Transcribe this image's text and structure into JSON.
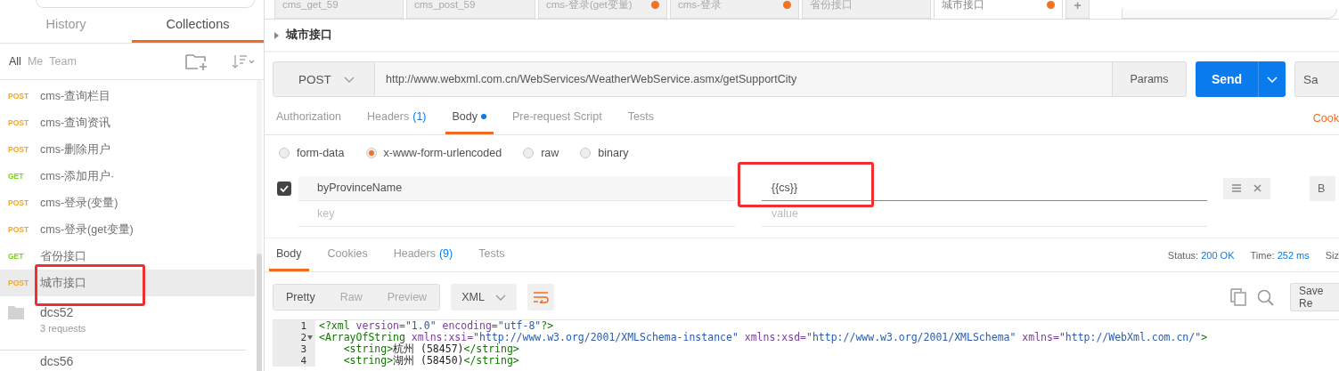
{
  "sidebar": {
    "tabs": [
      {
        "label": "History",
        "selected": false
      },
      {
        "label": "Collections",
        "selected": true
      }
    ],
    "filters": [
      {
        "label": "All",
        "selected": true
      },
      {
        "label": "Me",
        "selected": false
      },
      {
        "label": "Team",
        "selected": false
      }
    ],
    "requests": [
      {
        "method": "POST",
        "name": "cms-查询栏目",
        "selected": false,
        "highlighted": false
      },
      {
        "method": "POST",
        "name": "cms-查询资讯",
        "selected": false,
        "highlighted": false
      },
      {
        "method": "POST",
        "name": "cms-删除用户",
        "selected": false,
        "highlighted": false
      },
      {
        "method": "GET",
        "name": "cms-添加用户·",
        "selected": false,
        "highlighted": false
      },
      {
        "method": "POST",
        "name": "cms-登录(变量)",
        "selected": false,
        "highlighted": false
      },
      {
        "method": "POST",
        "name": "cms-登录(get变量)",
        "selected": false,
        "highlighted": false
      },
      {
        "method": "GET",
        "name": "省份接口",
        "selected": false,
        "highlighted": false
      },
      {
        "method": "POST",
        "name": "城市接口",
        "selected": true,
        "highlighted": true
      }
    ],
    "folders": [
      {
        "name": "dcs52",
        "count": "3 requests"
      },
      {
        "name": "dcs56"
      }
    ]
  },
  "tabs": [
    {
      "label": "cms_get_59",
      "unsaved": false,
      "selected": false
    },
    {
      "label": "cms_post_59",
      "unsaved": false,
      "selected": false
    },
    {
      "label": "cms-登录(get变量)",
      "unsaved": true,
      "selected": false
    },
    {
      "label": "cms-登录",
      "unsaved": true,
      "selected": false
    },
    {
      "label": "省份接口",
      "unsaved": false,
      "selected": false
    },
    {
      "label": "城市接口",
      "unsaved": true,
      "selected": true
    }
  ],
  "new_tab": "+",
  "request_title": "城市接口",
  "url_bar": {
    "method": "POST",
    "url": "http://www.webxml.com.cn/WebServices/WeatherWebService.asmx/getSupportCity",
    "params": "Params",
    "send": "Send",
    "save": "Sa"
  },
  "request_tabs": [
    {
      "label": "Authorization",
      "dot": false,
      "selected": false
    },
    {
      "label": "Headers",
      "count": "(1)",
      "dot": false,
      "selected": false
    },
    {
      "label": "Body",
      "dot": true,
      "selected": true
    },
    {
      "label": "Pre-request Script",
      "dot": false,
      "selected": false
    },
    {
      "label": "Tests",
      "dot": false,
      "selected": false
    }
  ],
  "cookies_link": "Cook",
  "body_types": [
    {
      "label": "form-data",
      "selected": false
    },
    {
      "label": "x-www-form-urlencoded",
      "selected": true
    },
    {
      "label": "raw",
      "selected": false
    },
    {
      "label": "binary",
      "selected": false
    }
  ],
  "params": [
    {
      "checked": true,
      "key": "byProvinceName",
      "value": "{{cs}}",
      "highlighted": true
    }
  ],
  "new_param": {
    "key_placeholder": "key",
    "value_placeholder": "value"
  },
  "bulk_edit": "B",
  "response_tabs": [
    {
      "label": "Body",
      "selected": true
    },
    {
      "label": "Cookies",
      "selected": false
    },
    {
      "label": "Headers",
      "count": "(9)",
      "selected": false
    },
    {
      "label": "Tests",
      "selected": false
    }
  ],
  "status": [
    {
      "label": "Status:",
      "value": "200 OK"
    },
    {
      "label": "Time:",
      "value": "252 ms"
    }
  ],
  "size_label": "Siz",
  "view_modes": [
    {
      "label": "Pretty",
      "selected": true
    },
    {
      "label": "Raw",
      "selected": false
    },
    {
      "label": "Preview",
      "selected": false
    }
  ],
  "format": "XML",
  "save_response": "Save Re",
  "code": [
    {
      "number": "1",
      "foldable": false,
      "tokens": [
        {
          "kind": "tag",
          "text": "<?xml "
        },
        {
          "kind": "attr",
          "text": "version="
        },
        {
          "kind": "string",
          "text": "\"1.0\""
        },
        {
          "kind": "attr",
          "text": " encoding="
        },
        {
          "kind": "string",
          "text": "\"utf-8\""
        },
        {
          "kind": "tag",
          "text": "?>"
        }
      ]
    },
    {
      "number": "2",
      "foldable": true,
      "tokens": [
        {
          "kind": "tag",
          "text": "<ArrayOfString "
        },
        {
          "kind": "attr",
          "text": "xmlns:xsi="
        },
        {
          "kind": "string",
          "text": "\"http://www.w3.org/2001/XMLSchema-instance\""
        },
        {
          "kind": "attr",
          "text": " xmlns:xsd="
        },
        {
          "kind": "string",
          "text": "\"http://www.w3.org/2001/XMLSchema\""
        },
        {
          "kind": "attr",
          "text": " xmlns="
        },
        {
          "kind": "string",
          "text": "\"http://WebXml.com.cn/\""
        },
        {
          "kind": "tag",
          "text": ">"
        }
      ]
    },
    {
      "number": "3",
      "foldable": false,
      "tokens": [
        {
          "kind": "tag",
          "text": "    <string>"
        },
        {
          "kind": "text",
          "text": "杭州 (58457)"
        },
        {
          "kind": "tag",
          "text": "</string>"
        }
      ]
    },
    {
      "number": "4",
      "foldable": false,
      "tokens": [
        {
          "kind": "tag",
          "text": "    <string>"
        },
        {
          "kind": "text",
          "text": "湖州 (58450)"
        },
        {
          "kind": "tag",
          "text": "</string>"
        }
      ]
    }
  ]
}
